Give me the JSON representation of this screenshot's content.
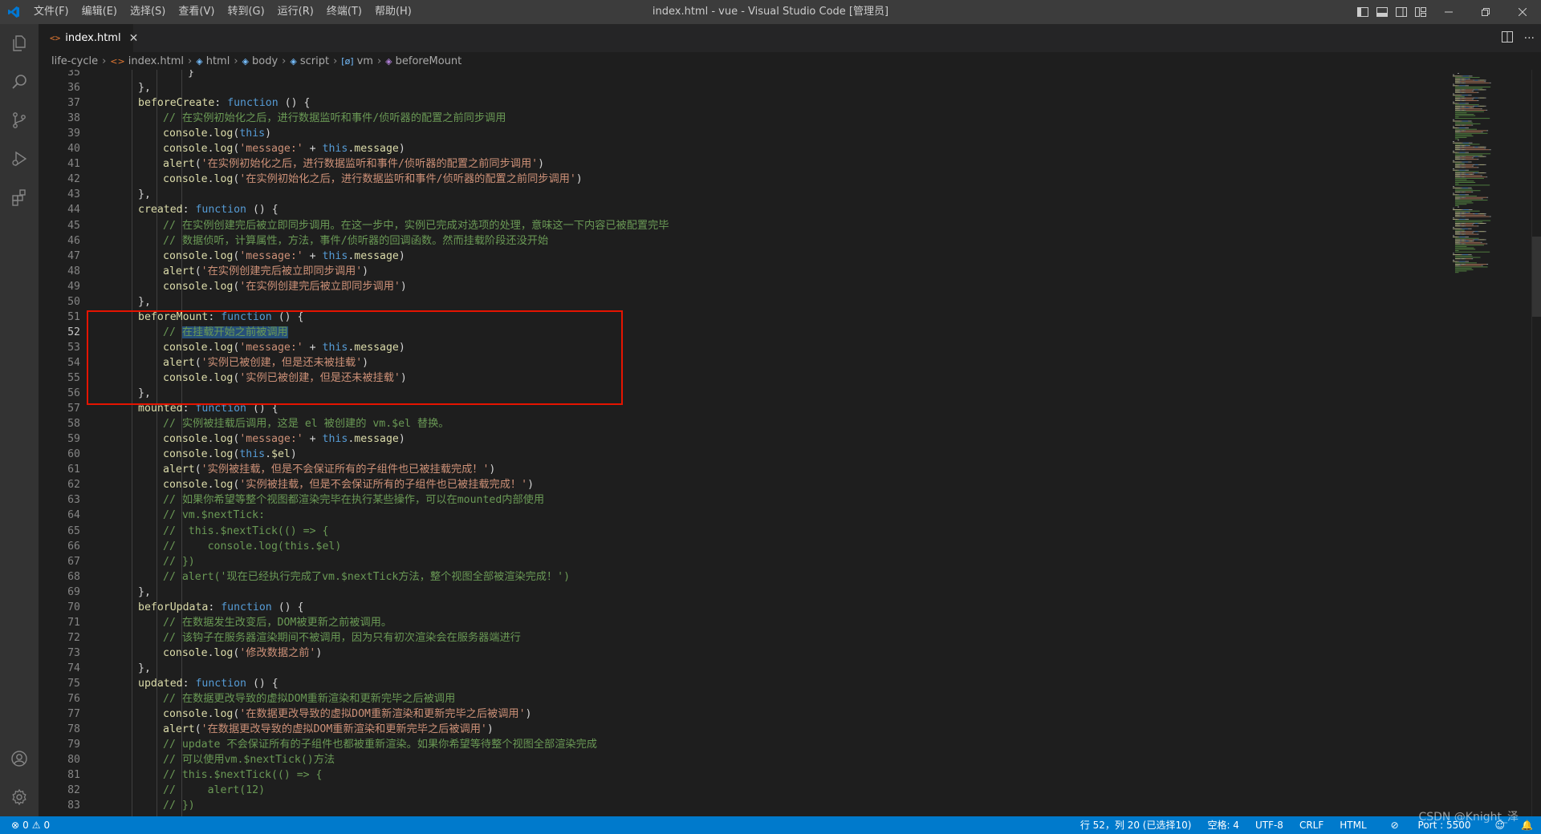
{
  "titlebar": {
    "menu": [
      "文件(F)",
      "编辑(E)",
      "选择(S)",
      "查看(V)",
      "转到(G)",
      "运行(R)",
      "终端(T)",
      "帮助(H)"
    ],
    "window_title": "index.html - vue - Visual Studio Code [管理员]"
  },
  "tabs": [
    {
      "label": "index.html",
      "icon": "html-file-icon",
      "active": true
    }
  ],
  "breadcrumb": [
    "life-cycle",
    "index.html",
    "html",
    "body",
    "script",
    "vm",
    "beforeMount"
  ],
  "editor": {
    "current_line": 52,
    "accent_highlight": "#e51400",
    "lines": [
      {
        "n": "35",
        "i": 6,
        "t": [
          [
            "}",
            "pl"
          ]
        ]
      },
      {
        "n": "36",
        "i": 4,
        "t": [
          [
            "},",
            "pl"
          ]
        ]
      },
      {
        "n": "37",
        "i": 4,
        "t": [
          [
            "beforeCreate",
            "prop"
          ],
          [
            ": ",
            "pl"
          ],
          [
            "function",
            "kw"
          ],
          [
            " () {",
            "pl"
          ]
        ]
      },
      {
        "n": "38",
        "i": 5,
        "t": [
          [
            "// 在实例初始化之后，进行数据监听和事件/侦听器的配置之前同步调用",
            "cm"
          ]
        ]
      },
      {
        "n": "39",
        "i": 5,
        "t": [
          [
            "console",
            "prop"
          ],
          [
            ".",
            "pl"
          ],
          [
            "log",
            "fn"
          ],
          [
            "(",
            "pl"
          ],
          [
            "this",
            "kw"
          ],
          [
            ")",
            "pl"
          ]
        ]
      },
      {
        "n": "40",
        "i": 5,
        "t": [
          [
            "console",
            "prop"
          ],
          [
            ".",
            "pl"
          ],
          [
            "log",
            "fn"
          ],
          [
            "(",
            "pl"
          ],
          [
            "'message:'",
            "str"
          ],
          [
            " + ",
            "pl"
          ],
          [
            "this",
            "kw"
          ],
          [
            ".",
            "pl"
          ],
          [
            "message",
            "prop"
          ],
          [
            ")",
            "pl"
          ]
        ]
      },
      {
        "n": "41",
        "i": 5,
        "t": [
          [
            "alert",
            "fn"
          ],
          [
            "(",
            "pl"
          ],
          [
            "'在实例初始化之后，进行数据监听和事件/侦听器的配置之前同步调用'",
            "str"
          ],
          [
            ")",
            "pl"
          ]
        ]
      },
      {
        "n": "42",
        "i": 5,
        "t": [
          [
            "console",
            "prop"
          ],
          [
            ".",
            "pl"
          ],
          [
            "log",
            "fn"
          ],
          [
            "(",
            "pl"
          ],
          [
            "'在实例初始化之后，进行数据监听和事件/侦听器的配置之前同步调用'",
            "str"
          ],
          [
            ")",
            "pl"
          ]
        ]
      },
      {
        "n": "43",
        "i": 4,
        "t": [
          [
            "},",
            "pl"
          ]
        ]
      },
      {
        "n": "44",
        "i": 4,
        "t": [
          [
            "created",
            "prop"
          ],
          [
            ": ",
            "pl"
          ],
          [
            "function",
            "kw"
          ],
          [
            " () {",
            "pl"
          ]
        ]
      },
      {
        "n": "45",
        "i": 5,
        "t": [
          [
            "// 在实例创建完后被立即同步调用。在这一步中，实例已完成对选项的处理，意味这一下内容已被配置完毕",
            "cm"
          ]
        ]
      },
      {
        "n": "46",
        "i": 5,
        "t": [
          [
            "// 数据侦听，计算属性，方法，事件/侦听器的回调函数。然而挂载阶段还没开始",
            "cm"
          ]
        ]
      },
      {
        "n": "47",
        "i": 5,
        "t": [
          [
            "console",
            "prop"
          ],
          [
            ".",
            "pl"
          ],
          [
            "log",
            "fn"
          ],
          [
            "(",
            "pl"
          ],
          [
            "'message:'",
            "str"
          ],
          [
            " + ",
            "pl"
          ],
          [
            "this",
            "kw"
          ],
          [
            ".",
            "pl"
          ],
          [
            "message",
            "prop"
          ],
          [
            ")",
            "pl"
          ]
        ]
      },
      {
        "n": "48",
        "i": 5,
        "t": [
          [
            "alert",
            "fn"
          ],
          [
            "(",
            "pl"
          ],
          [
            "'在实例创建完后被立即同步调用'",
            "str"
          ],
          [
            ")",
            "pl"
          ]
        ]
      },
      {
        "n": "49",
        "i": 5,
        "t": [
          [
            "console",
            "prop"
          ],
          [
            ".",
            "pl"
          ],
          [
            "log",
            "fn"
          ],
          [
            "(",
            "pl"
          ],
          [
            "'在实例创建完后被立即同步调用'",
            "str"
          ],
          [
            ")",
            "pl"
          ]
        ]
      },
      {
        "n": "50",
        "i": 4,
        "t": [
          [
            "},",
            "pl"
          ]
        ]
      },
      {
        "n": "51",
        "i": 4,
        "t": [
          [
            "beforeMount",
            "prop"
          ],
          [
            ": ",
            "pl"
          ],
          [
            "function",
            "kw"
          ],
          [
            " () {",
            "pl"
          ]
        ]
      },
      {
        "n": "52",
        "i": 5,
        "t": [
          [
            "// ",
            "cm"
          ],
          [
            "在挂载开始之前被调用",
            "cm sel"
          ]
        ]
      },
      {
        "n": "53",
        "i": 5,
        "t": [
          [
            "console",
            "prop"
          ],
          [
            ".",
            "pl"
          ],
          [
            "log",
            "fn"
          ],
          [
            "(",
            "pl"
          ],
          [
            "'message:'",
            "str"
          ],
          [
            " + ",
            "pl"
          ],
          [
            "this",
            "kw"
          ],
          [
            ".",
            "pl"
          ],
          [
            "message",
            "prop"
          ],
          [
            ")",
            "pl"
          ]
        ]
      },
      {
        "n": "54",
        "i": 5,
        "t": [
          [
            "alert",
            "fn"
          ],
          [
            "(",
            "pl"
          ],
          [
            "'实例已被创建，但是还未被挂载'",
            "str"
          ],
          [
            ")",
            "pl"
          ]
        ]
      },
      {
        "n": "55",
        "i": 5,
        "t": [
          [
            "console",
            "prop"
          ],
          [
            ".",
            "pl"
          ],
          [
            "log",
            "fn"
          ],
          [
            "(",
            "pl"
          ],
          [
            "'实例已被创建，但是还未被挂载'",
            "str"
          ],
          [
            ")",
            "pl"
          ]
        ]
      },
      {
        "n": "56",
        "i": 4,
        "t": [
          [
            "},",
            "pl"
          ]
        ]
      },
      {
        "n": "57",
        "i": 4,
        "t": [
          [
            "mounted",
            "prop"
          ],
          [
            ": ",
            "pl"
          ],
          [
            "function",
            "kw"
          ],
          [
            " () {",
            "pl"
          ]
        ]
      },
      {
        "n": "58",
        "i": 5,
        "t": [
          [
            "// 实例被挂载后调用，这是 el 被创建的 vm.$el 替换。",
            "cm"
          ]
        ]
      },
      {
        "n": "59",
        "i": 5,
        "t": [
          [
            "console",
            "prop"
          ],
          [
            ".",
            "pl"
          ],
          [
            "log",
            "fn"
          ],
          [
            "(",
            "pl"
          ],
          [
            "'message:'",
            "str"
          ],
          [
            " + ",
            "pl"
          ],
          [
            "this",
            "kw"
          ],
          [
            ".",
            "pl"
          ],
          [
            "message",
            "prop"
          ],
          [
            ")",
            "pl"
          ]
        ]
      },
      {
        "n": "60",
        "i": 5,
        "t": [
          [
            "console",
            "prop"
          ],
          [
            ".",
            "pl"
          ],
          [
            "log",
            "fn"
          ],
          [
            "(",
            "pl"
          ],
          [
            "this",
            "kw"
          ],
          [
            ".",
            "pl"
          ],
          [
            "$el",
            "prop"
          ],
          [
            ")",
            "pl"
          ]
        ]
      },
      {
        "n": "61",
        "i": 5,
        "t": [
          [
            "alert",
            "fn"
          ],
          [
            "(",
            "pl"
          ],
          [
            "'实例被挂载，但是不会保证所有的子组件也已被挂载完成！'",
            "str"
          ],
          [
            ")",
            "pl"
          ]
        ]
      },
      {
        "n": "62",
        "i": 5,
        "t": [
          [
            "console",
            "prop"
          ],
          [
            ".",
            "pl"
          ],
          [
            "log",
            "fn"
          ],
          [
            "(",
            "pl"
          ],
          [
            "'实例被挂载，但是不会保证所有的子组件也已被挂载完成！'",
            "str"
          ],
          [
            ")",
            "pl"
          ]
        ]
      },
      {
        "n": "63",
        "i": 5,
        "t": [
          [
            "// 如果你希望等整个视图都渲染完毕在执行某些操作，可以在mounted内部使用",
            "cm"
          ]
        ]
      },
      {
        "n": "64",
        "i": 5,
        "t": [
          [
            "// vm.$nextTick:",
            "cm"
          ]
        ]
      },
      {
        "n": "65",
        "i": 5,
        "t": [
          [
            "//  this.$nextTick(() => {",
            "cm"
          ]
        ]
      },
      {
        "n": "66",
        "i": 5,
        "t": [
          [
            "//     console.log(this.$el)",
            "cm"
          ]
        ]
      },
      {
        "n": "67",
        "i": 5,
        "t": [
          [
            "// })",
            "cm"
          ]
        ]
      },
      {
        "n": "68",
        "i": 5,
        "t": [
          [
            "// alert('现在已经执行完成了vm.$nextTick方法，整个视图全部被渲染完成！')",
            "cm"
          ]
        ]
      },
      {
        "n": "69",
        "i": 4,
        "t": [
          [
            "},",
            "pl"
          ]
        ]
      },
      {
        "n": "70",
        "i": 4,
        "t": [
          [
            "beforUpdata",
            "prop"
          ],
          [
            ": ",
            "pl"
          ],
          [
            "function",
            "kw"
          ],
          [
            " () {",
            "pl"
          ]
        ]
      },
      {
        "n": "71",
        "i": 5,
        "t": [
          [
            "// 在数据发生改变后，DOM被更新之前被调用。",
            "cm"
          ]
        ]
      },
      {
        "n": "72",
        "i": 5,
        "t": [
          [
            "// 该钩子在服务器渲染期间不被调用，因为只有初次渲染会在服务器端进行",
            "cm"
          ]
        ]
      },
      {
        "n": "73",
        "i": 5,
        "t": [
          [
            "console",
            "prop"
          ],
          [
            ".",
            "pl"
          ],
          [
            "log",
            "fn"
          ],
          [
            "(",
            "pl"
          ],
          [
            "'修改数据之前'",
            "str"
          ],
          [
            ")",
            "pl"
          ]
        ]
      },
      {
        "n": "74",
        "i": 4,
        "t": [
          [
            "},",
            "pl"
          ]
        ]
      },
      {
        "n": "75",
        "i": 4,
        "t": [
          [
            "updated",
            "prop"
          ],
          [
            ": ",
            "pl"
          ],
          [
            "function",
            "kw"
          ],
          [
            " () {",
            "pl"
          ]
        ]
      },
      {
        "n": "76",
        "i": 5,
        "t": [
          [
            "// 在数据更改导致的虚拟DOM重新渲染和更新完毕之后被调用",
            "cm"
          ]
        ]
      },
      {
        "n": "77",
        "i": 5,
        "t": [
          [
            "console",
            "prop"
          ],
          [
            ".",
            "pl"
          ],
          [
            "log",
            "fn"
          ],
          [
            "(",
            "pl"
          ],
          [
            "'在数据更改导致的虚拟DOM重新渲染和更新完毕之后被调用'",
            "str"
          ],
          [
            ")",
            "pl"
          ]
        ]
      },
      {
        "n": "78",
        "i": 5,
        "t": [
          [
            "alert",
            "fn"
          ],
          [
            "(",
            "pl"
          ],
          [
            "'在数据更改导致的虚拟DOM重新渲染和更新完毕之后被调用'",
            "str"
          ],
          [
            ")",
            "pl"
          ]
        ]
      },
      {
        "n": "79",
        "i": 5,
        "t": [
          [
            "// update 不会保证所有的子组件也都被重新渲染。如果你希望等待整个视图全部渲染完成",
            "cm"
          ]
        ]
      },
      {
        "n": "80",
        "i": 5,
        "t": [
          [
            "// 可以使用vm.$nextTick()方法",
            "cm"
          ]
        ]
      },
      {
        "n": "81",
        "i": 5,
        "t": [
          [
            "// this.$nextTick(() => {",
            "cm"
          ]
        ]
      },
      {
        "n": "82",
        "i": 5,
        "t": [
          [
            "//     alert(12)",
            "cm"
          ]
        ]
      },
      {
        "n": "83",
        "i": 5,
        "t": [
          [
            "// })",
            "cm"
          ]
        ]
      }
    ]
  },
  "statusbar": {
    "problems_errors": "0",
    "problems_warnings": "0",
    "position": "行 52，列 20 (已选择10)",
    "spaces": "空格: 4",
    "encoding": "UTF-8",
    "eol": "CRLF",
    "language": "HTML",
    "port": "Port : 5500"
  },
  "watermark": "CSDN @Knight_泽"
}
